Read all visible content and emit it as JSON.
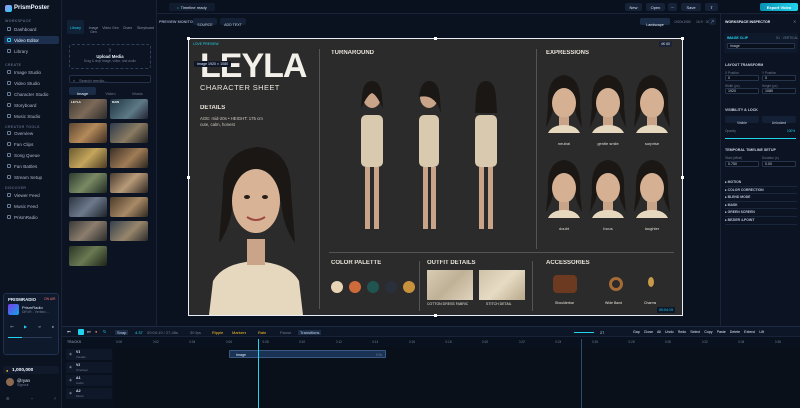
{
  "app": {
    "name": "PrismPoster"
  },
  "sidebar": {
    "sections": [
      {
        "title": "WORKSPACE",
        "items": [
          {
            "label": "Dashboard",
            "active": false
          },
          {
            "label": "Video Editor",
            "active": true
          },
          {
            "label": "Library",
            "active": false
          }
        ]
      },
      {
        "title": "CREATE",
        "items": [
          {
            "label": "Image Studio"
          },
          {
            "label": "Video Studio"
          },
          {
            "label": "Character Studio"
          },
          {
            "label": "Storyboard"
          },
          {
            "label": "Music Studio"
          }
        ]
      },
      {
        "title": "CREATOR TOOLS",
        "items": [
          {
            "label": "Overview"
          },
          {
            "label": "Fan Clips"
          },
          {
            "label": "Song Queue"
          },
          {
            "label": "Fan Battles"
          },
          {
            "label": "Stream Setup"
          }
        ]
      },
      {
        "title": "DISCOVER",
        "items": [
          {
            "label": "Viewer Feed"
          },
          {
            "label": "Music Feed"
          },
          {
            "label": "PrismRadio"
          }
        ]
      }
    ]
  },
  "radio": {
    "title": "PRISMRADIO",
    "status": "ON AIR",
    "station": "PrismRadio",
    "track": "DiFoR - Verbinc..."
  },
  "user": {
    "name": "@ryan",
    "role": "Signout",
    "credits": "1,000,000"
  },
  "panel": {
    "tabs": [
      "Library",
      "Image Gen",
      "Video Gen",
      "Chars",
      "Storyboard"
    ],
    "upload_title": "Upload Media",
    "upload_hint": "Drag & drop image, video, and audio",
    "search_placeholder": "Search media...",
    "filters": [
      "Image",
      "Video",
      "Music"
    ],
    "thumb_labels": [
      "LEYLA",
      "RAIN"
    ]
  },
  "topbar": {
    "project_label": "PROJECT",
    "project_name": "Test",
    "status": "Timeline ready",
    "buttons": [
      "New",
      "Open",
      "Save"
    ],
    "export": "Export Video"
  },
  "preview": {
    "title": "PREVIEW MONITOR",
    "source": "SOURCE",
    "add_text": "ADD TEXT",
    "aspect": "Landscape",
    "res": "1920x1080",
    "fps": "16:9 · 30",
    "quality": "4K 60",
    "badge": "Image 1920 × 1080",
    "timecode": "00:04:19"
  },
  "sheet": {
    "tag": "LOVE PREVIEW",
    "name": "LEYLA",
    "subtitle": "CHARACTER SHEET",
    "details_h": "DETAILS",
    "details_1": "AGE: mid-20s  •  HEIGHT: 175 cm",
    "details_2": "cute, calm, honest",
    "turnaround_h": "TURNAROUND",
    "expressions_h": "EXPRESSIONS",
    "expressions": [
      "neutral",
      "gentle smile",
      "surprise",
      "doubt",
      "focus",
      "laughter"
    ],
    "palette_h": "COLOR PALETTE",
    "palette": [
      "#e8d4b4",
      "#cf6a3a",
      "#1f5450",
      "#2a2f3c",
      "#c8913c"
    ],
    "outfit_h": "OUTFIT DETAILS",
    "outfit": [
      "COTTON DRESS FABRIC",
      "STITCH DETAIL"
    ],
    "acc_h": "ACCESSORIES",
    "accessories": [
      "Shoulderbar",
      "Wide Band",
      "Charms"
    ]
  },
  "inspector": {
    "title": "WORKSPACE INSPECTOR",
    "clip_label": "IMAGE CLIP",
    "clip_sub": "S1 · VERTICAL",
    "clip_name": "image",
    "layout_h": "LAYOUT TRANSFORM",
    "x_l": "X Position",
    "x_v": "0",
    "y_l": "Y Position",
    "y_v": "0",
    "w_l": "Width (px)",
    "w_v": "1920",
    "h_l": "Height (px)",
    "h_v": "1080",
    "vis_h": "VISIBILITY & LOCK",
    "visible": "Visible",
    "unlocked": "Unlocked",
    "op_l": "Opacity",
    "op_v": "100%",
    "opacity": 1.0,
    "timing_h": "TEMPORAL TIMELINE SETUP",
    "start_l": "Start (offset)",
    "start_v": "0.750",
    "dur_l": "Duration (s)",
    "dur_v": "0.00",
    "groups": [
      "MOTION",
      "COLOR CORRECTION",
      "BLEND MODE",
      "MASK",
      "GREEN SCREEN",
      "BEZIER 4-POINT"
    ]
  },
  "timeline": {
    "play_time": "4.37",
    "play_total": "00:04:19 / 27.48s",
    "fps": "30 fps",
    "snap": "Snap",
    "modes": [
      "Ripple",
      "Markers",
      "Rate",
      "Pause",
      "Transitions"
    ],
    "zoom": "27",
    "tools": [
      "Gap",
      "Close",
      "All",
      "Undo",
      "Redo",
      "Select",
      "Copy",
      "Paste",
      "Delete",
      "Extend",
      "Lift"
    ],
    "tracks_label": "TRACKS",
    "tracks": [
      {
        "id": "V1",
        "name": "Visuals"
      },
      {
        "id": "V2",
        "name": "Overlays"
      },
      {
        "id": "A1",
        "name": "Audio"
      },
      {
        "id": "A2",
        "name": "Music"
      }
    ],
    "ruler": [
      "0:00",
      "0:02",
      "0:04",
      "0:06",
      "0:08",
      "0:10",
      "0:12",
      "0:14",
      "0:16",
      "0:18",
      "0:20",
      "0:22",
      "0:24",
      "0:26",
      "0:28",
      "0:30",
      "0:32",
      "0:34",
      "0:36"
    ],
    "clip_name": "Image",
    "clip_len": "0.0s"
  },
  "colors": {
    "accent": "#22d3ee",
    "brand": "#8b5cf6",
    "bg": "#070b14"
  }
}
